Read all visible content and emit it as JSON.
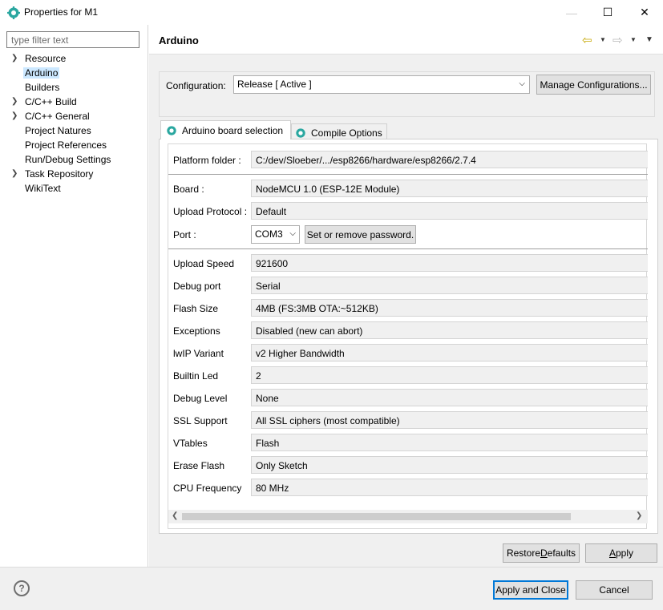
{
  "window": {
    "title": "Properties for M1"
  },
  "left": {
    "filter_placeholder": "type filter text",
    "items": [
      {
        "label": "Resource",
        "expandable": true
      },
      {
        "label": "Arduino",
        "expandable": false,
        "selected": true
      },
      {
        "label": "Builders",
        "expandable": false
      },
      {
        "label": "C/C++ Build",
        "expandable": true
      },
      {
        "label": "C/C++ General",
        "expandable": true
      },
      {
        "label": "Project Natures",
        "expandable": false
      },
      {
        "label": "Project References",
        "expandable": false
      },
      {
        "label": "Run/Debug Settings",
        "expandable": false
      },
      {
        "label": "Task Repository",
        "expandable": true
      },
      {
        "label": "WikiText",
        "expandable": false
      }
    ]
  },
  "page": {
    "title": "Arduino"
  },
  "config": {
    "label": "Configuration:",
    "value": "Release  [ Active ]",
    "manage_label": "Manage Configurations..."
  },
  "tabs": [
    {
      "label": "Arduino board selection",
      "active": true
    },
    {
      "label": "Compile Options",
      "active": false
    }
  ],
  "board": {
    "platform_label": "Platform folder :",
    "platform_value": "C:/dev/Sloeber/.../esp8266/hardware/esp8266/2.7.4",
    "board_label": "Board :",
    "board_value": "NodeMCU 1.0 (ESP-12E Module)",
    "upload_protocol_label": "Upload Protocol :",
    "upload_protocol_value": "Default",
    "port_label": "Port :",
    "port_value": "COM3",
    "password_button": "Set or remove password.",
    "options": [
      {
        "label": "Upload Speed",
        "value": "921600"
      },
      {
        "label": "Debug port",
        "value": "Serial"
      },
      {
        "label": "Flash Size",
        "value": "4MB (FS:3MB OTA:~512KB)"
      },
      {
        "label": "Exceptions",
        "value": "Disabled (new can abort)"
      },
      {
        "label": "lwIP Variant",
        "value": "v2 Higher Bandwidth"
      },
      {
        "label": "Builtin Led",
        "value": "2"
      },
      {
        "label": "Debug Level",
        "value": "None"
      },
      {
        "label": "SSL Support",
        "value": "All SSL ciphers (most compatible)"
      },
      {
        "label": "VTables",
        "value": "Flash"
      },
      {
        "label": "Erase Flash",
        "value": "Only Sketch"
      },
      {
        "label": "CPU Frequency",
        "value": "80 MHz"
      }
    ]
  },
  "buttons": {
    "restore_pre": "Restore ",
    "restore_u": "D",
    "restore_post": "efaults",
    "apply_u": "A",
    "apply_post": "pply",
    "apply_close": "Apply and Close",
    "cancel": "Cancel"
  },
  "icons": {
    "app": "sloeber-gear-icon",
    "help": "help-icon",
    "back": "back-arrow-icon",
    "forward": "forward-arrow-icon"
  },
  "colors": {
    "selection": "#cce8ff",
    "focus": "#0078d7",
    "back_arrow": "#c6a700"
  }
}
